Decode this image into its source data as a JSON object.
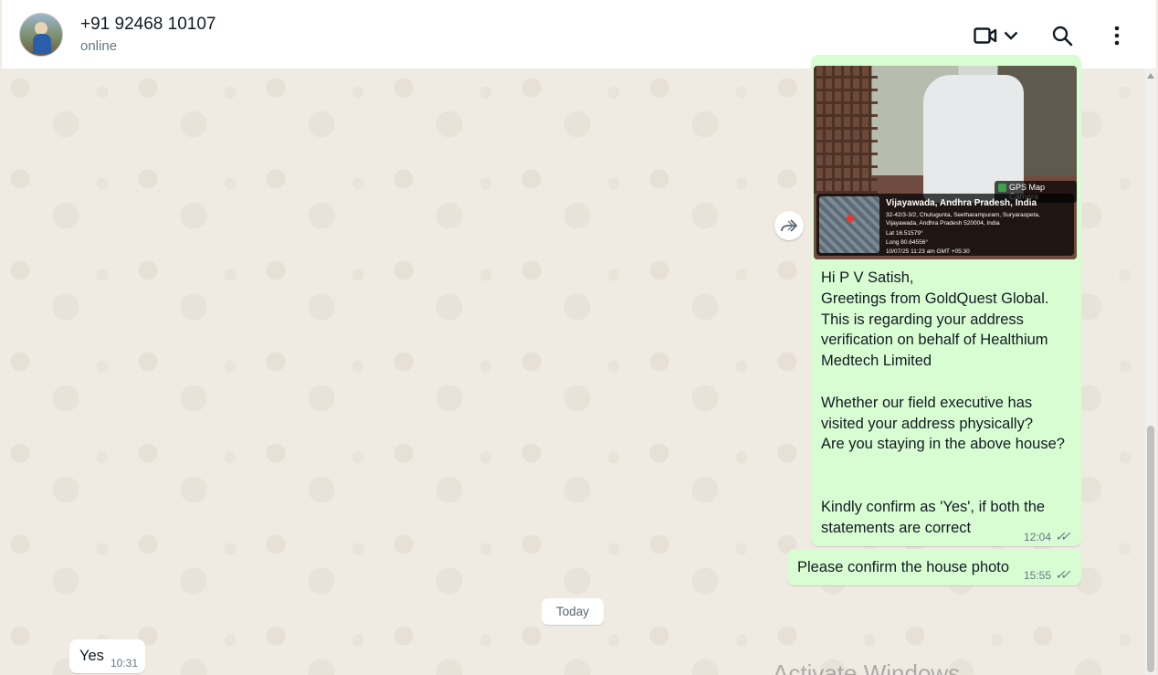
{
  "header": {
    "contact_name": "+91 92468 10107",
    "status": "online",
    "icons": [
      "video-call-icon",
      "chevron-down-icon",
      "search-icon",
      "menu-icon"
    ]
  },
  "messages": {
    "photo": {
      "stamp_label": "GPS Map Camera",
      "city": "Vijayawada, Andhra Pradesh, India",
      "address_line1": "32-42/3-3/2, Chutugunta, Seetharampuram, Suryaraopeta,",
      "address_line2": "Vijayawada, Andhra Pradesh 520004, India",
      "lat": "Lat 16.51579°",
      "long": "Long 80.64556°",
      "datetime": "10/07/25 11:23 am GMT +05:30"
    },
    "verification": {
      "text": "Hi P V Satish,\nGreetings from GoldQuest Global.\nThis is regarding your address\nverification on behalf of Healthium\nMedtech Limited\n\nWhether our field executive has\nvisited your address physically?\nAre you staying in the above house?\n\n\nKindly confirm as 'Yes', if both the\nstatements are correct",
      "time": "12:04"
    },
    "confirm_photo": {
      "text": "Please confirm the house photo",
      "time": "15:55"
    },
    "date_divider": "Today",
    "reply": {
      "text": "Yes",
      "time": "10:31"
    }
  },
  "watermark": "Activate Windows",
  "colors": {
    "outgoing_bubble": "#d9fdd3",
    "incoming_bubble": "#ffffff",
    "chat_background": "#efeae2"
  }
}
